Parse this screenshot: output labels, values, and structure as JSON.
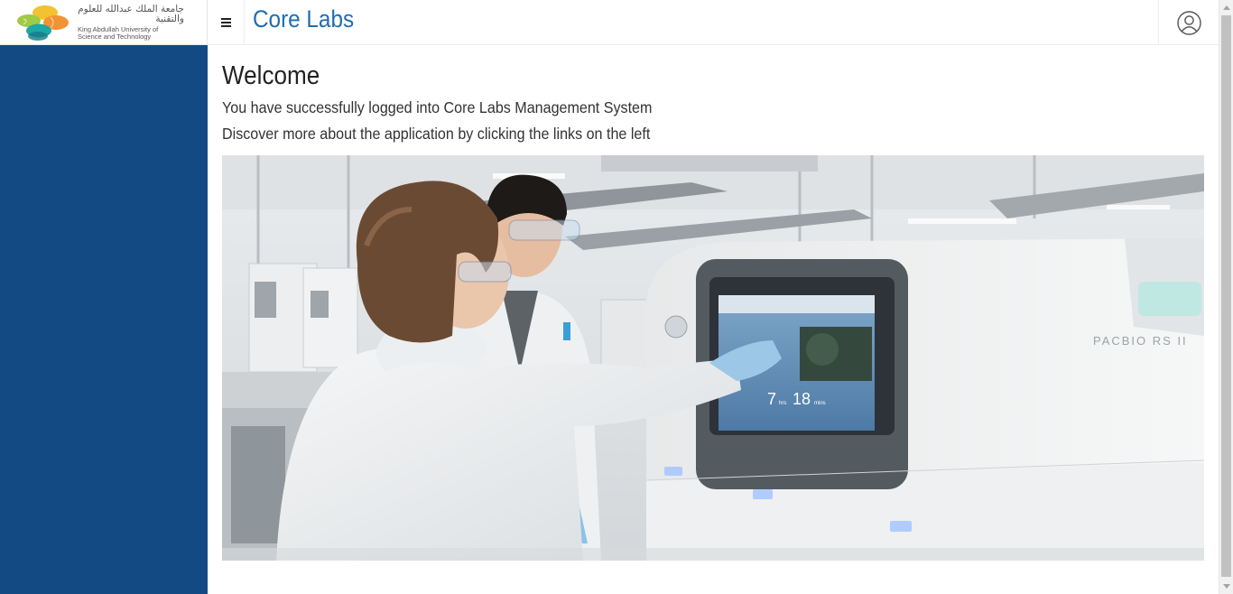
{
  "logo": {
    "arabic_name": "جامعة الملك عبدالله للعلوم والتقنية",
    "english_line1": "King Abdullah University of",
    "english_line2": "Science and Technology"
  },
  "header": {
    "menu_icon": "hamburger-icon",
    "app_title": "Core Labs",
    "user_icon": "user-circle-icon"
  },
  "main": {
    "welcome_title": "Welcome",
    "line1": "You have successfully logged into Core Labs Management System",
    "line2": "Discover more about the application by clicking the links on the left",
    "hero_image": {
      "screen_numbers": [
        "7",
        "18"
      ],
      "screen_units": [
        "hrs",
        "mins"
      ],
      "instrument_label": "PACBIO RS II"
    }
  },
  "colors": {
    "sidebar": "#134a83",
    "accent": "#1f6db0",
    "text": "#222222"
  }
}
